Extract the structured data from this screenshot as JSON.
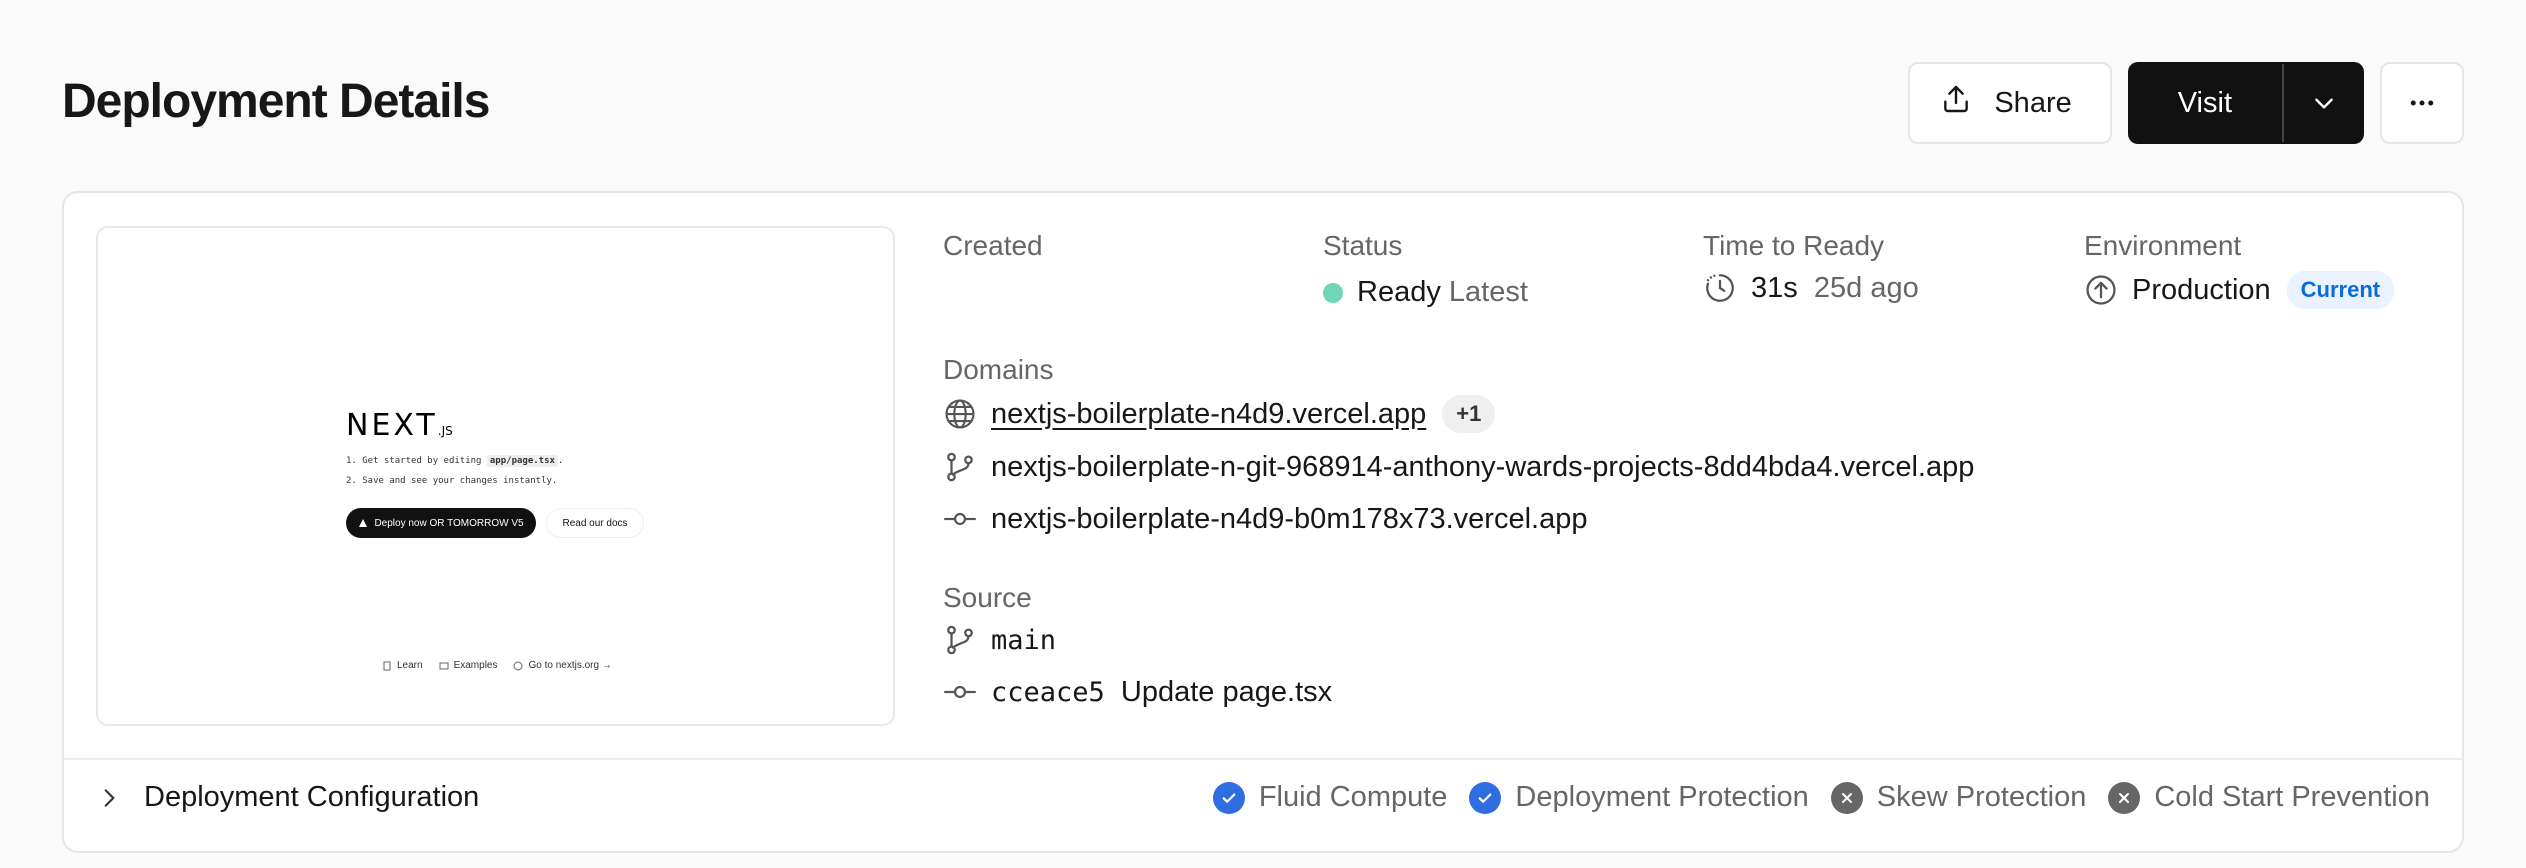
{
  "header": {
    "title": "Deployment Details",
    "share_label": "Share",
    "visit_label": "Visit"
  },
  "preview": {
    "logo_text": "NEXT",
    "logo_suffix": ".JS",
    "step1_prefix": "1. Get started by editing ",
    "step1_code": "app/page.tsx",
    "step1_suffix": ".",
    "step2": "2. Save and see your changes instantly.",
    "deploy_button": "Deploy now OR TOMORROW V5",
    "docs_button": "Read our docs",
    "footer_learn": "Learn",
    "footer_examples": "Examples",
    "footer_nextjs": "Go to nextjs.org →"
  },
  "details": {
    "created_label": "Created",
    "status_label": "Status",
    "status_value": "Ready",
    "status_tag": "Latest",
    "time_label": "Time to Ready",
    "time_value": "31s",
    "time_ago": "25d ago",
    "env_label": "Environment",
    "env_value": "Production",
    "env_badge": "Current",
    "status_color": "#6fd6b6"
  },
  "domains": {
    "label": "Domains",
    "primary": "nextjs-boilerplate-n4d9.vercel.app",
    "extra_count": "+1",
    "git_domain": "nextjs-boilerplate-n-git-968914-anthony-wards-projects-8dd4bda4.vercel.app",
    "commit_domain": "nextjs-boilerplate-n4d9-b0m178x73.vercel.app"
  },
  "source": {
    "label": "Source",
    "branch": "main",
    "commit_hash": "cceace5",
    "commit_message": "Update page.tsx"
  },
  "config": {
    "label": "Deployment Configuration",
    "features": [
      {
        "label": "Fluid Compute",
        "enabled": true
      },
      {
        "label": "Deployment Protection",
        "enabled": true
      },
      {
        "label": "Skew Protection",
        "enabled": false
      },
      {
        "label": "Cold Start Prevention",
        "enabled": false
      }
    ],
    "enabled_color": "#2f6de1",
    "disabled_color": "#666666"
  }
}
